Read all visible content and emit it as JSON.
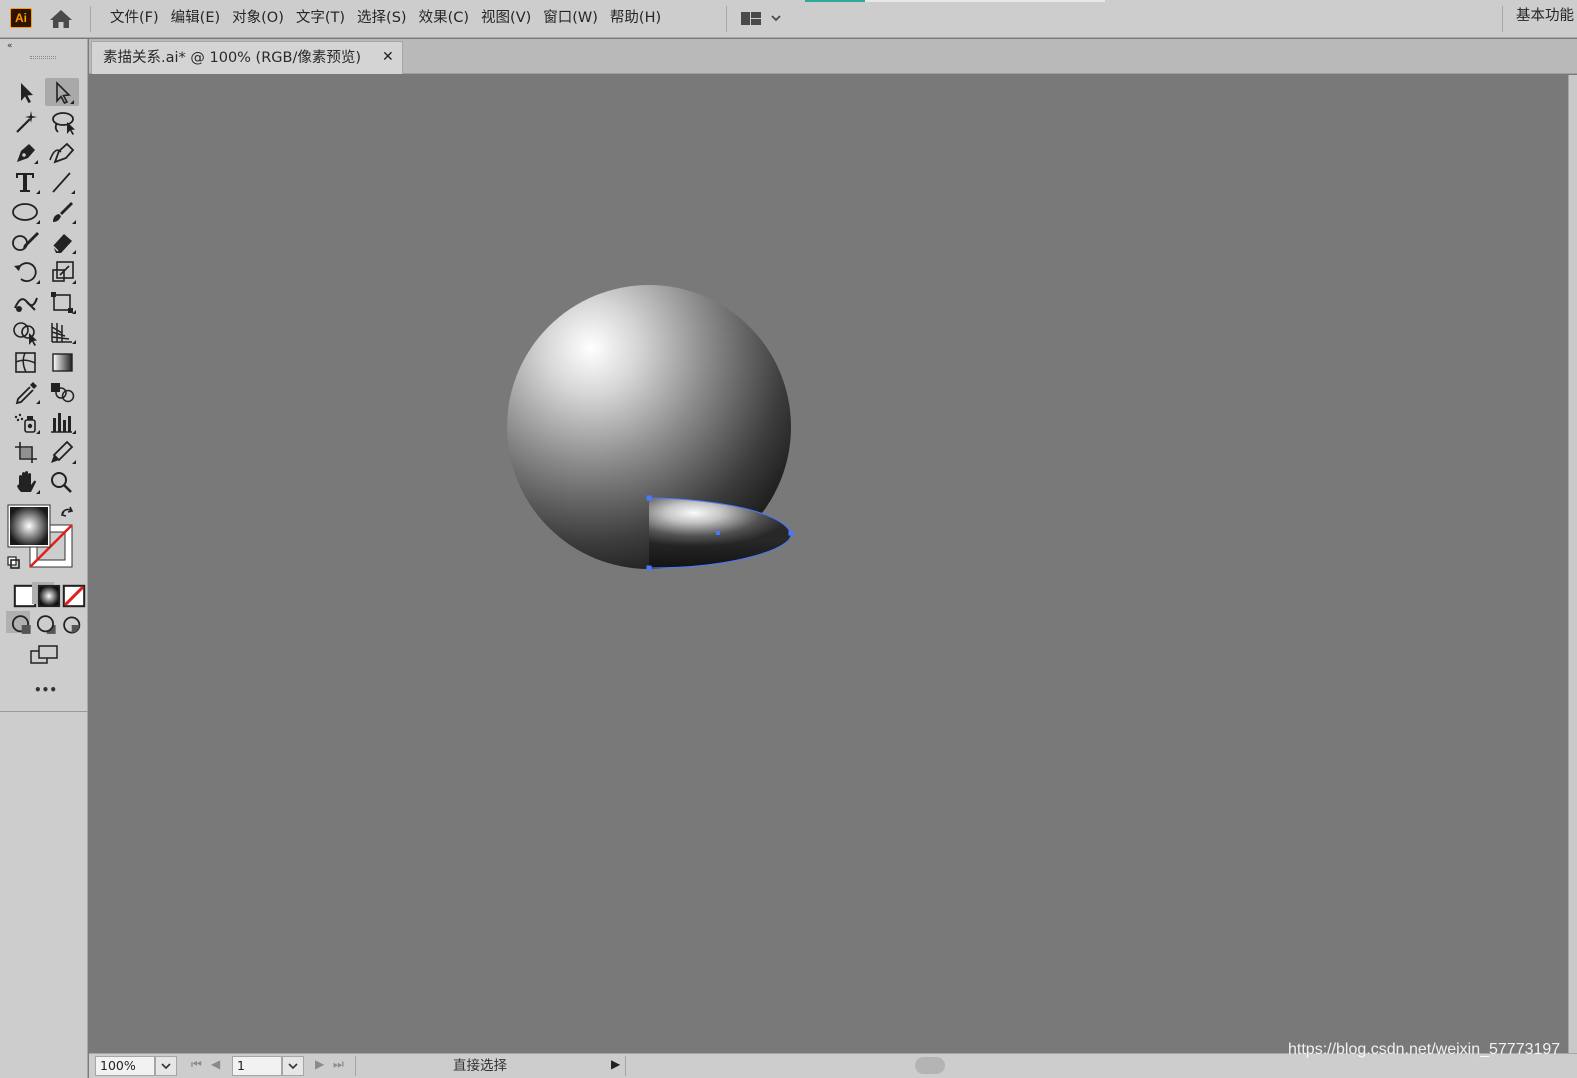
{
  "app": {
    "logo_text": "Ai"
  },
  "menu": {
    "items": [
      "文件(F)",
      "编辑(E)",
      "对象(O)",
      "文字(T)",
      "选择(S)",
      "效果(C)",
      "视图(V)",
      "窗口(W)",
      "帮助(H)"
    ],
    "workspace_label": "基本功能"
  },
  "document": {
    "tab_title": "素描关系.ai* @ 100% (RGB/像素预览)",
    "close_glyph": "✕"
  },
  "toolbar": {
    "collapse_glyph": "«",
    "more_glyph": "•••"
  },
  "status": {
    "zoom": "100%",
    "artboard": "1",
    "current_tool": "直接选择"
  },
  "watermark": "https://blog.csdn.net/weixin_57773197",
  "colors": {
    "canvas": "#797979",
    "chrome": "#cdcdcd",
    "selection": "#4a78ff",
    "logo_orange": "#ff9a00"
  }
}
